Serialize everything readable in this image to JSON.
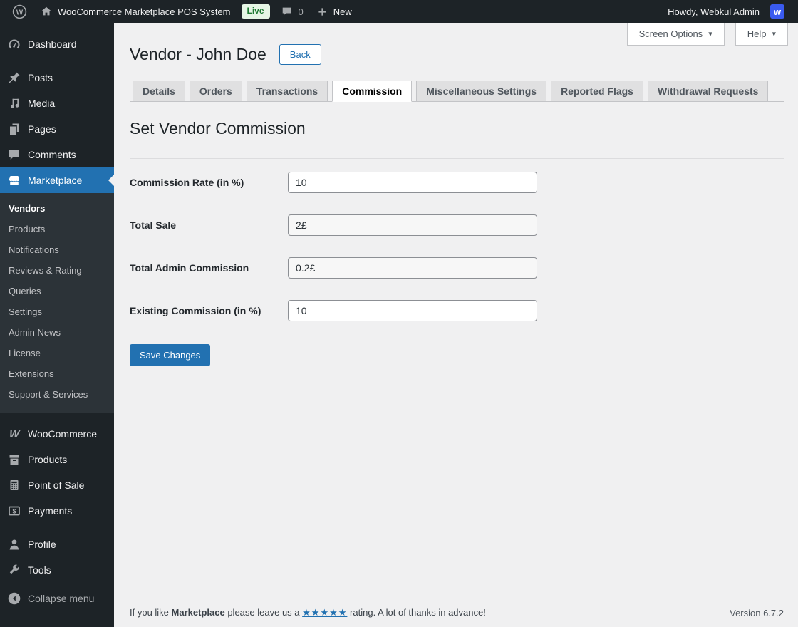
{
  "admin_bar": {
    "site_name": "WooCommerce Marketplace POS System",
    "live_badge": "Live",
    "comment_count": "0",
    "new_label": "New",
    "howdy_text": "Howdy, Webkul Admin",
    "avatar_letter": "w"
  },
  "toolbar": {
    "screen_options_label": "Screen Options",
    "help_label": "Help"
  },
  "sidebar": {
    "items": [
      {
        "label": "Dashboard"
      },
      {
        "label": "Posts"
      },
      {
        "label": "Media"
      },
      {
        "label": "Pages"
      },
      {
        "label": "Comments"
      },
      {
        "label": "Marketplace"
      },
      {
        "label": "WooCommerce"
      },
      {
        "label": "Products"
      },
      {
        "label": "Point of Sale"
      },
      {
        "label": "Payments"
      },
      {
        "label": "Profile"
      },
      {
        "label": "Tools"
      }
    ],
    "submenu": [
      {
        "label": "Vendors"
      },
      {
        "label": "Products"
      },
      {
        "label": "Notifications"
      },
      {
        "label": "Reviews & Rating"
      },
      {
        "label": "Queries"
      },
      {
        "label": "Settings"
      },
      {
        "label": "Admin News"
      },
      {
        "label": "License"
      },
      {
        "label": "Extensions"
      },
      {
        "label": "Support & Services"
      }
    ],
    "collapse_label": "Collapse menu"
  },
  "page": {
    "title": "Vendor - John Doe",
    "back_label": "Back",
    "tabs": [
      {
        "label": "Details"
      },
      {
        "label": "Orders"
      },
      {
        "label": "Transactions"
      },
      {
        "label": "Commission"
      },
      {
        "label": "Miscellaneous Settings"
      },
      {
        "label": "Reported Flags"
      },
      {
        "label": "Withdrawal Requests"
      }
    ],
    "active_tab": "Commission",
    "section_title": "Set Vendor Commission",
    "form": {
      "fields": [
        {
          "label": "Commission Rate (in %)",
          "value": "10"
        },
        {
          "label": "Total Sale",
          "value": "2£"
        },
        {
          "label": "Total Admin Commission",
          "value": "0.2£"
        },
        {
          "label": "Existing Commission (in %)",
          "value": "10"
        }
      ],
      "save_label": "Save Changes"
    }
  },
  "footer": {
    "message_prefix": "If you like",
    "plugin_name": "Marketplace",
    "message_mid": "please leave us a",
    "stars": "★★★★★",
    "message_suffix": "rating. A lot of thanks in advance!",
    "version": "Version 6.7.2"
  },
  "colors": {
    "accent": "#2271b1",
    "admin_bar_bg": "#1d2327",
    "sidebar_bg": "#1d2327",
    "submenu_bg": "#2c3338",
    "content_bg": "#f0f0f1",
    "live_badge_bg": "#e6f6e6",
    "live_badge_text": "#1f7a33",
    "avatar_bg": "#3a5bef"
  }
}
